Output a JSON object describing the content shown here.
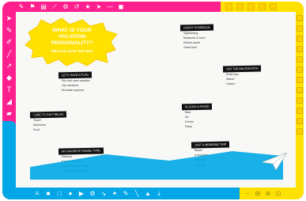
{
  "sticker": {
    "line1": "WHAT IS YOUR",
    "line2": "VACATION",
    "line3": "PERSONALITY?",
    "line4": "Take your pick! Test Quiz"
  },
  "cards": [
    {
      "header": "LET'S HAVE A PLAN",
      "items": [
        "Sun and sand vacation",
        "City wanderer",
        "Mountain explorer"
      ]
    },
    {
      "header": "A BUSY SCHEDULE",
      "items": [
        "Sightseeing",
        "Museums & more",
        "Historic spots",
        "Great food"
      ]
    },
    {
      "header": "I LIKE TO JUST RELAX",
      "items": [
        "Travel",
        "Adventure",
        "Food"
      ]
    },
    {
      "header": "MY FAVORITE TRAVEL TYPE",
      "items": [
        "Relaxed",
        "A quick weekend",
        "A road trip with friends",
        "A once in a lifetime trip"
      ]
    },
    {
      "header": "OFF THE BEATEN PATH",
      "items": [
        "Road trips",
        "Nature",
        "Culture"
      ]
    },
    {
      "header": "PLACES & FACES",
      "items": [
        "Bars",
        "Art",
        "Events",
        "Parks"
      ]
    },
    {
      "header": "JUST A WEEKEND TRIP",
      "items": [
        "Beach",
        "A mountain",
        "Camping",
        "Road trip"
      ]
    }
  ],
  "colors": {
    "frame": "#ff1f8e",
    "accent_blue": "#00a6e6",
    "accent_yellow": "#ffe100"
  }
}
